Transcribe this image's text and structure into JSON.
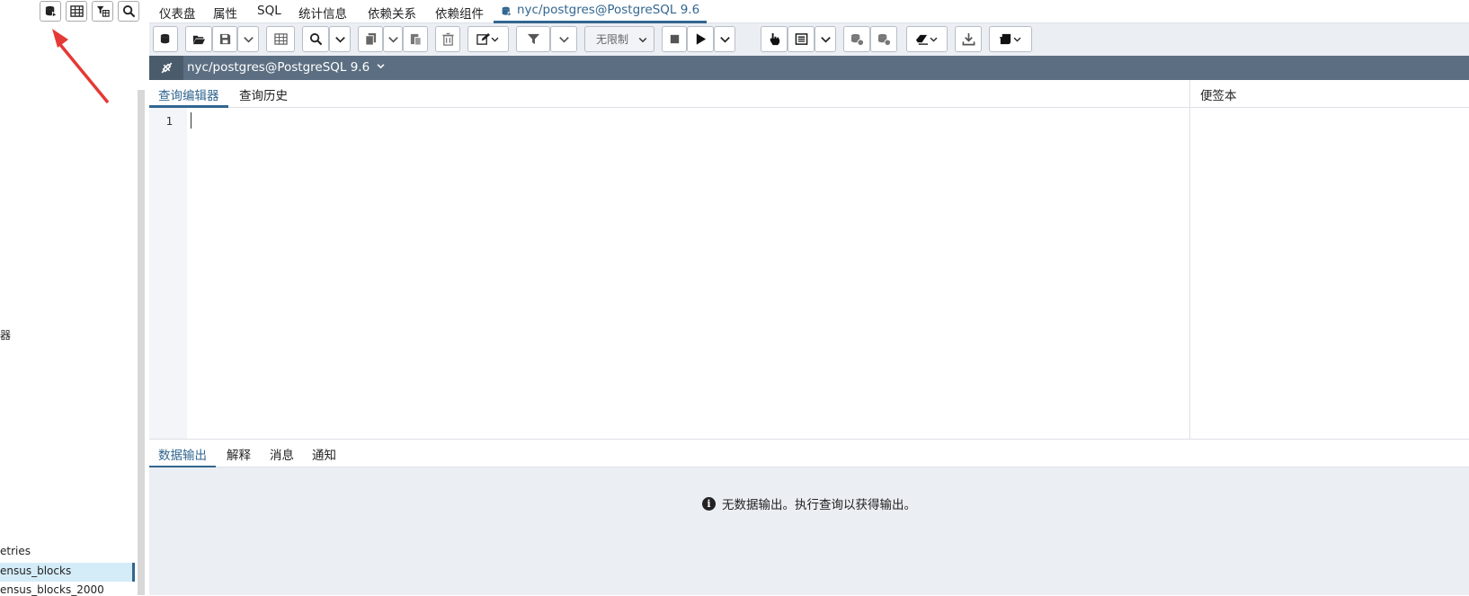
{
  "left_panel": {
    "tree_items": [
      {
        "label": "器"
      },
      {
        "label": "etries"
      },
      {
        "label": "ensus_blocks",
        "selected": true
      },
      {
        "label": "ensus_blocks_2000"
      }
    ]
  },
  "top_tabs": [
    {
      "label": "仪表盘"
    },
    {
      "label": "属性"
    },
    {
      "label": "SQL"
    },
    {
      "label": "统计信息"
    },
    {
      "label": "依赖关系"
    },
    {
      "label": "依赖组件"
    },
    {
      "label": "nyc/postgres@PostgreSQL 9.6",
      "active": true,
      "icon": "database-icon"
    }
  ],
  "toolbar": {
    "limit_label": "无限制"
  },
  "connection": {
    "label": "nyc/postgres@PostgreSQL 9.6"
  },
  "editor": {
    "tabs": [
      {
        "label": "查询编辑器",
        "active": true
      },
      {
        "label": "查询历史"
      }
    ],
    "line_number": "1"
  },
  "scratch_pad": {
    "title": "便签本"
  },
  "output": {
    "tabs": [
      {
        "label": "数据输出",
        "active": true
      },
      {
        "label": "解释"
      },
      {
        "label": "消息"
      },
      {
        "label": "通知"
      }
    ],
    "message": "无数据输出。执行查询以获得输出。"
  },
  "colors": {
    "accent": "#326690",
    "connection_bar": "#5c6f82",
    "toolbar_bg": "#ebeef3",
    "annotation_arrow": "#e53935"
  }
}
